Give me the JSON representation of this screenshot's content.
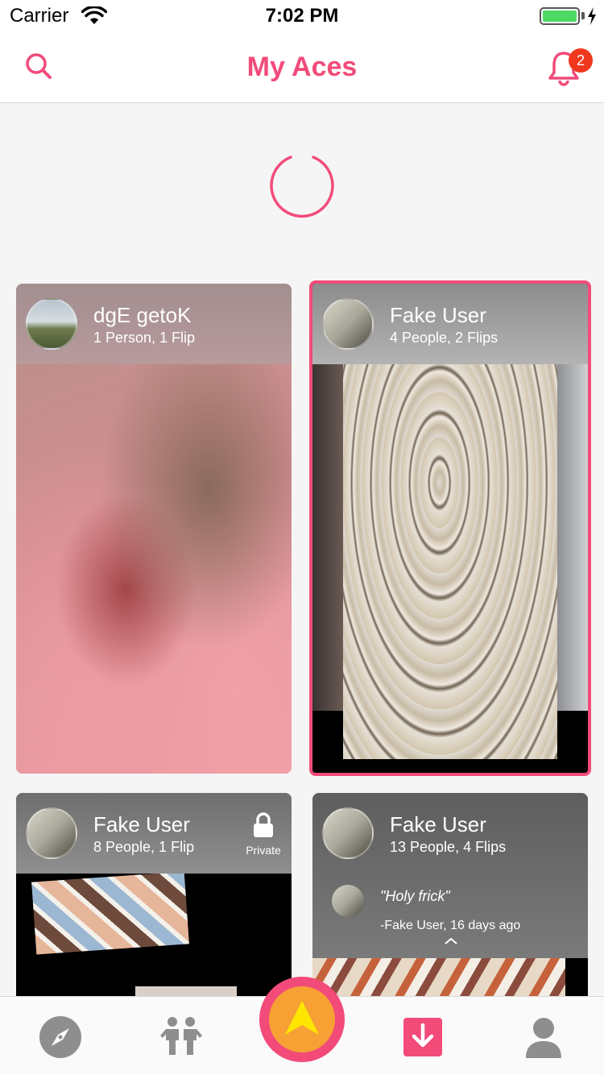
{
  "status_bar": {
    "carrier": "Carrier",
    "time": "7:02 PM"
  },
  "header": {
    "title": "My Aces",
    "notification_count": "2"
  },
  "colors": {
    "accent": "#f24b7a",
    "badge": "#f0381f",
    "fab_inner": "#f7a134",
    "fab_arrow": "#ffe600"
  },
  "cards": [
    {
      "name": "dgE getoK",
      "meta": "1 Person, 1 Flip",
      "selected": false
    },
    {
      "name": "Fake User",
      "meta": "4 People, 2 Flips",
      "selected": true
    },
    {
      "name": "Fake User",
      "meta": "8 People, 1 Flip",
      "private_label": "Private"
    },
    {
      "name": "Fake User",
      "meta": "13 People, 4 Flips",
      "quote": {
        "text": "\"Holy frick\"",
        "attribution": "-Fake User, 16 days ago"
      }
    }
  ],
  "tabs": [
    {
      "icon": "compass-icon"
    },
    {
      "icon": "people-icon"
    },
    {
      "icon": "create-ace-icon"
    },
    {
      "icon": "download-icon"
    },
    {
      "icon": "profile-icon"
    }
  ]
}
